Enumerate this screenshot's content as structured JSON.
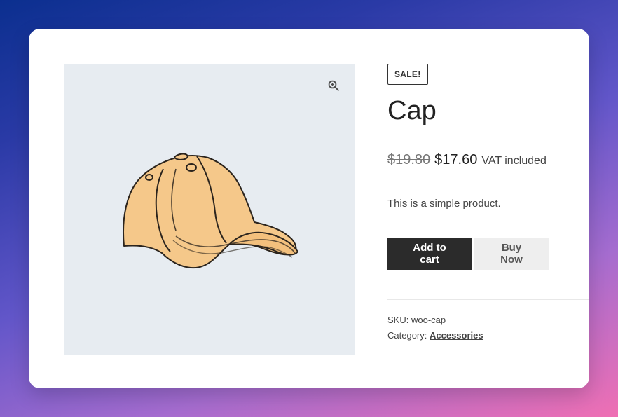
{
  "product": {
    "sale_badge": "SALE!",
    "title": "Cap",
    "price_old": "$19.80",
    "price_new": "$17.60",
    "price_suffix": "VAT included",
    "description": "This is a simple product.",
    "add_to_cart_label": "Add to cart",
    "buy_now_label": "Buy Now",
    "sku_label": "SKU:",
    "sku_value": "woo-cap",
    "category_label": "Category:",
    "category_value": "Accessories"
  },
  "icons": {
    "zoom": "zoom-in-icon"
  },
  "colors": {
    "add_to_cart_bg": "#2b2b2b",
    "buy_now_bg": "#eeeeee",
    "gallery_bg": "#e7ecf1"
  }
}
